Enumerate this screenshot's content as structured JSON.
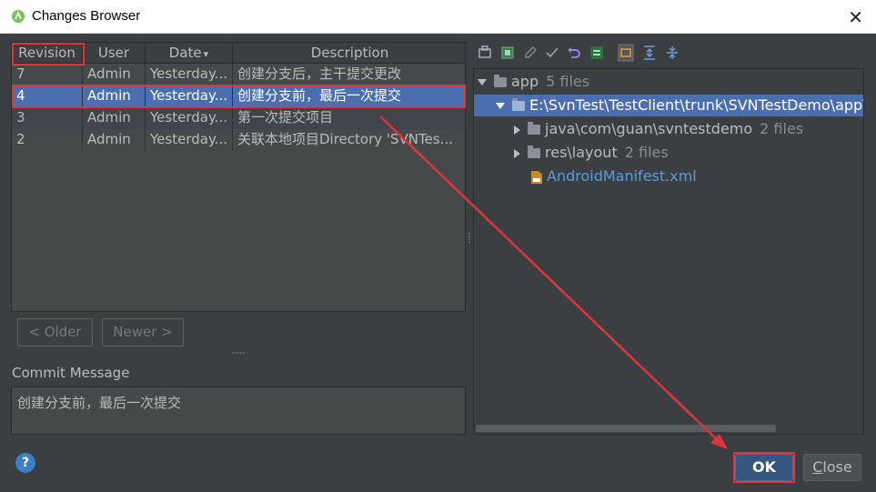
{
  "window": {
    "title": "Changes Browser",
    "close_glyph": "✕"
  },
  "table": {
    "headers": {
      "revision": "Revision",
      "user": "User",
      "date": "Date",
      "description": "Description"
    },
    "sort_glyph": "▾",
    "rows": [
      {
        "revision": "7",
        "user": "Admin",
        "date": "Yesterday...",
        "description": "创建分支后，主干提交更改"
      },
      {
        "revision": "4",
        "user": "Admin",
        "date": "Yesterday...",
        "description": "创建分支前，最后一次提交"
      },
      {
        "revision": "3",
        "user": "Admin",
        "date": "Yesterday...",
        "description": "第一次提交项目"
      },
      {
        "revision": "2",
        "user": "Admin",
        "date": "Yesterday...",
        "description": "关联本地项目Directory 'SVNTes..."
      }
    ],
    "selected_index": 1
  },
  "nav": {
    "older": "< Older",
    "newer": "Newer >"
  },
  "commit": {
    "label": "Commit Message",
    "text": "创建分支前，最后一次提交"
  },
  "tree": {
    "root": {
      "label": "app",
      "count": "5 files"
    },
    "path": {
      "label": "E:\\SvnTest\\TestClient\\trunk\\SVNTestDemo\\app\\"
    },
    "children": [
      {
        "label": "java\\com\\guan\\svntestdemo",
        "count": "2 files"
      },
      {
        "label": "res\\layout",
        "count": "2 files"
      }
    ],
    "file": {
      "label": "AndroidManifest.xml"
    }
  },
  "toolbar_icons": [
    "group-icon",
    "revert-icon",
    "edit-icon",
    "check-icon",
    "undo-icon",
    "diff-icon",
    "grouping-icon",
    "expand-all-icon",
    "collapse-all-icon"
  ],
  "buttons": {
    "ok": "OK",
    "close_underlined": "C",
    "close_rest": "lose",
    "help": "?"
  },
  "colors": {
    "accent": "#4b6eaf",
    "highlight": "#e0343e",
    "file_link": "#5c9bd8"
  }
}
